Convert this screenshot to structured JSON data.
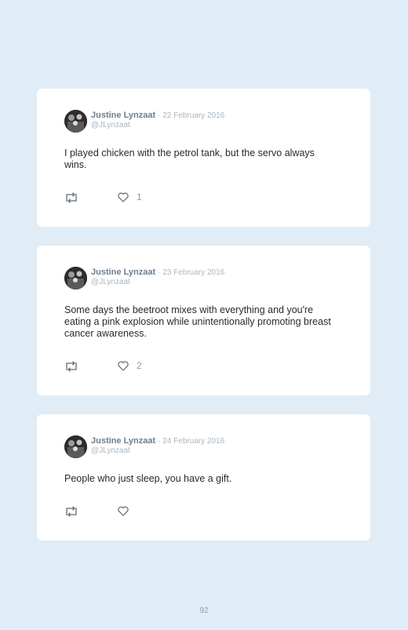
{
  "tweets": [
    {
      "name": "Justine Lynzaat",
      "date": "· 22 February 2016",
      "handle": "@JLynzaat",
      "text": "I played chicken with the petrol tank, but the servo always wins.",
      "likes": "1"
    },
    {
      "name": "Justine Lynzaat",
      "date": "· 23 February 2016",
      "handle": "@JLynzaat",
      "text": "Some days the beetroot mixes with everything and you're eating a pink explosion while unintentionally promoting breast cancer awareness.",
      "likes": "2"
    },
    {
      "name": "Justine Lynzaat",
      "date": "· 24 February 2016",
      "handle": "@JLynzaat",
      "text": "People who just sleep, you have a gift.",
      "likes": ""
    }
  ],
  "icons": {
    "retweet": "retweet-icon",
    "like": "heart-icon",
    "avatar": "avatar"
  },
  "colors": {
    "background": "#e1edf6",
    "card": "#ffffff",
    "name": "#6b7f90",
    "meta": "#a9b6c1"
  },
  "page_number": "92"
}
